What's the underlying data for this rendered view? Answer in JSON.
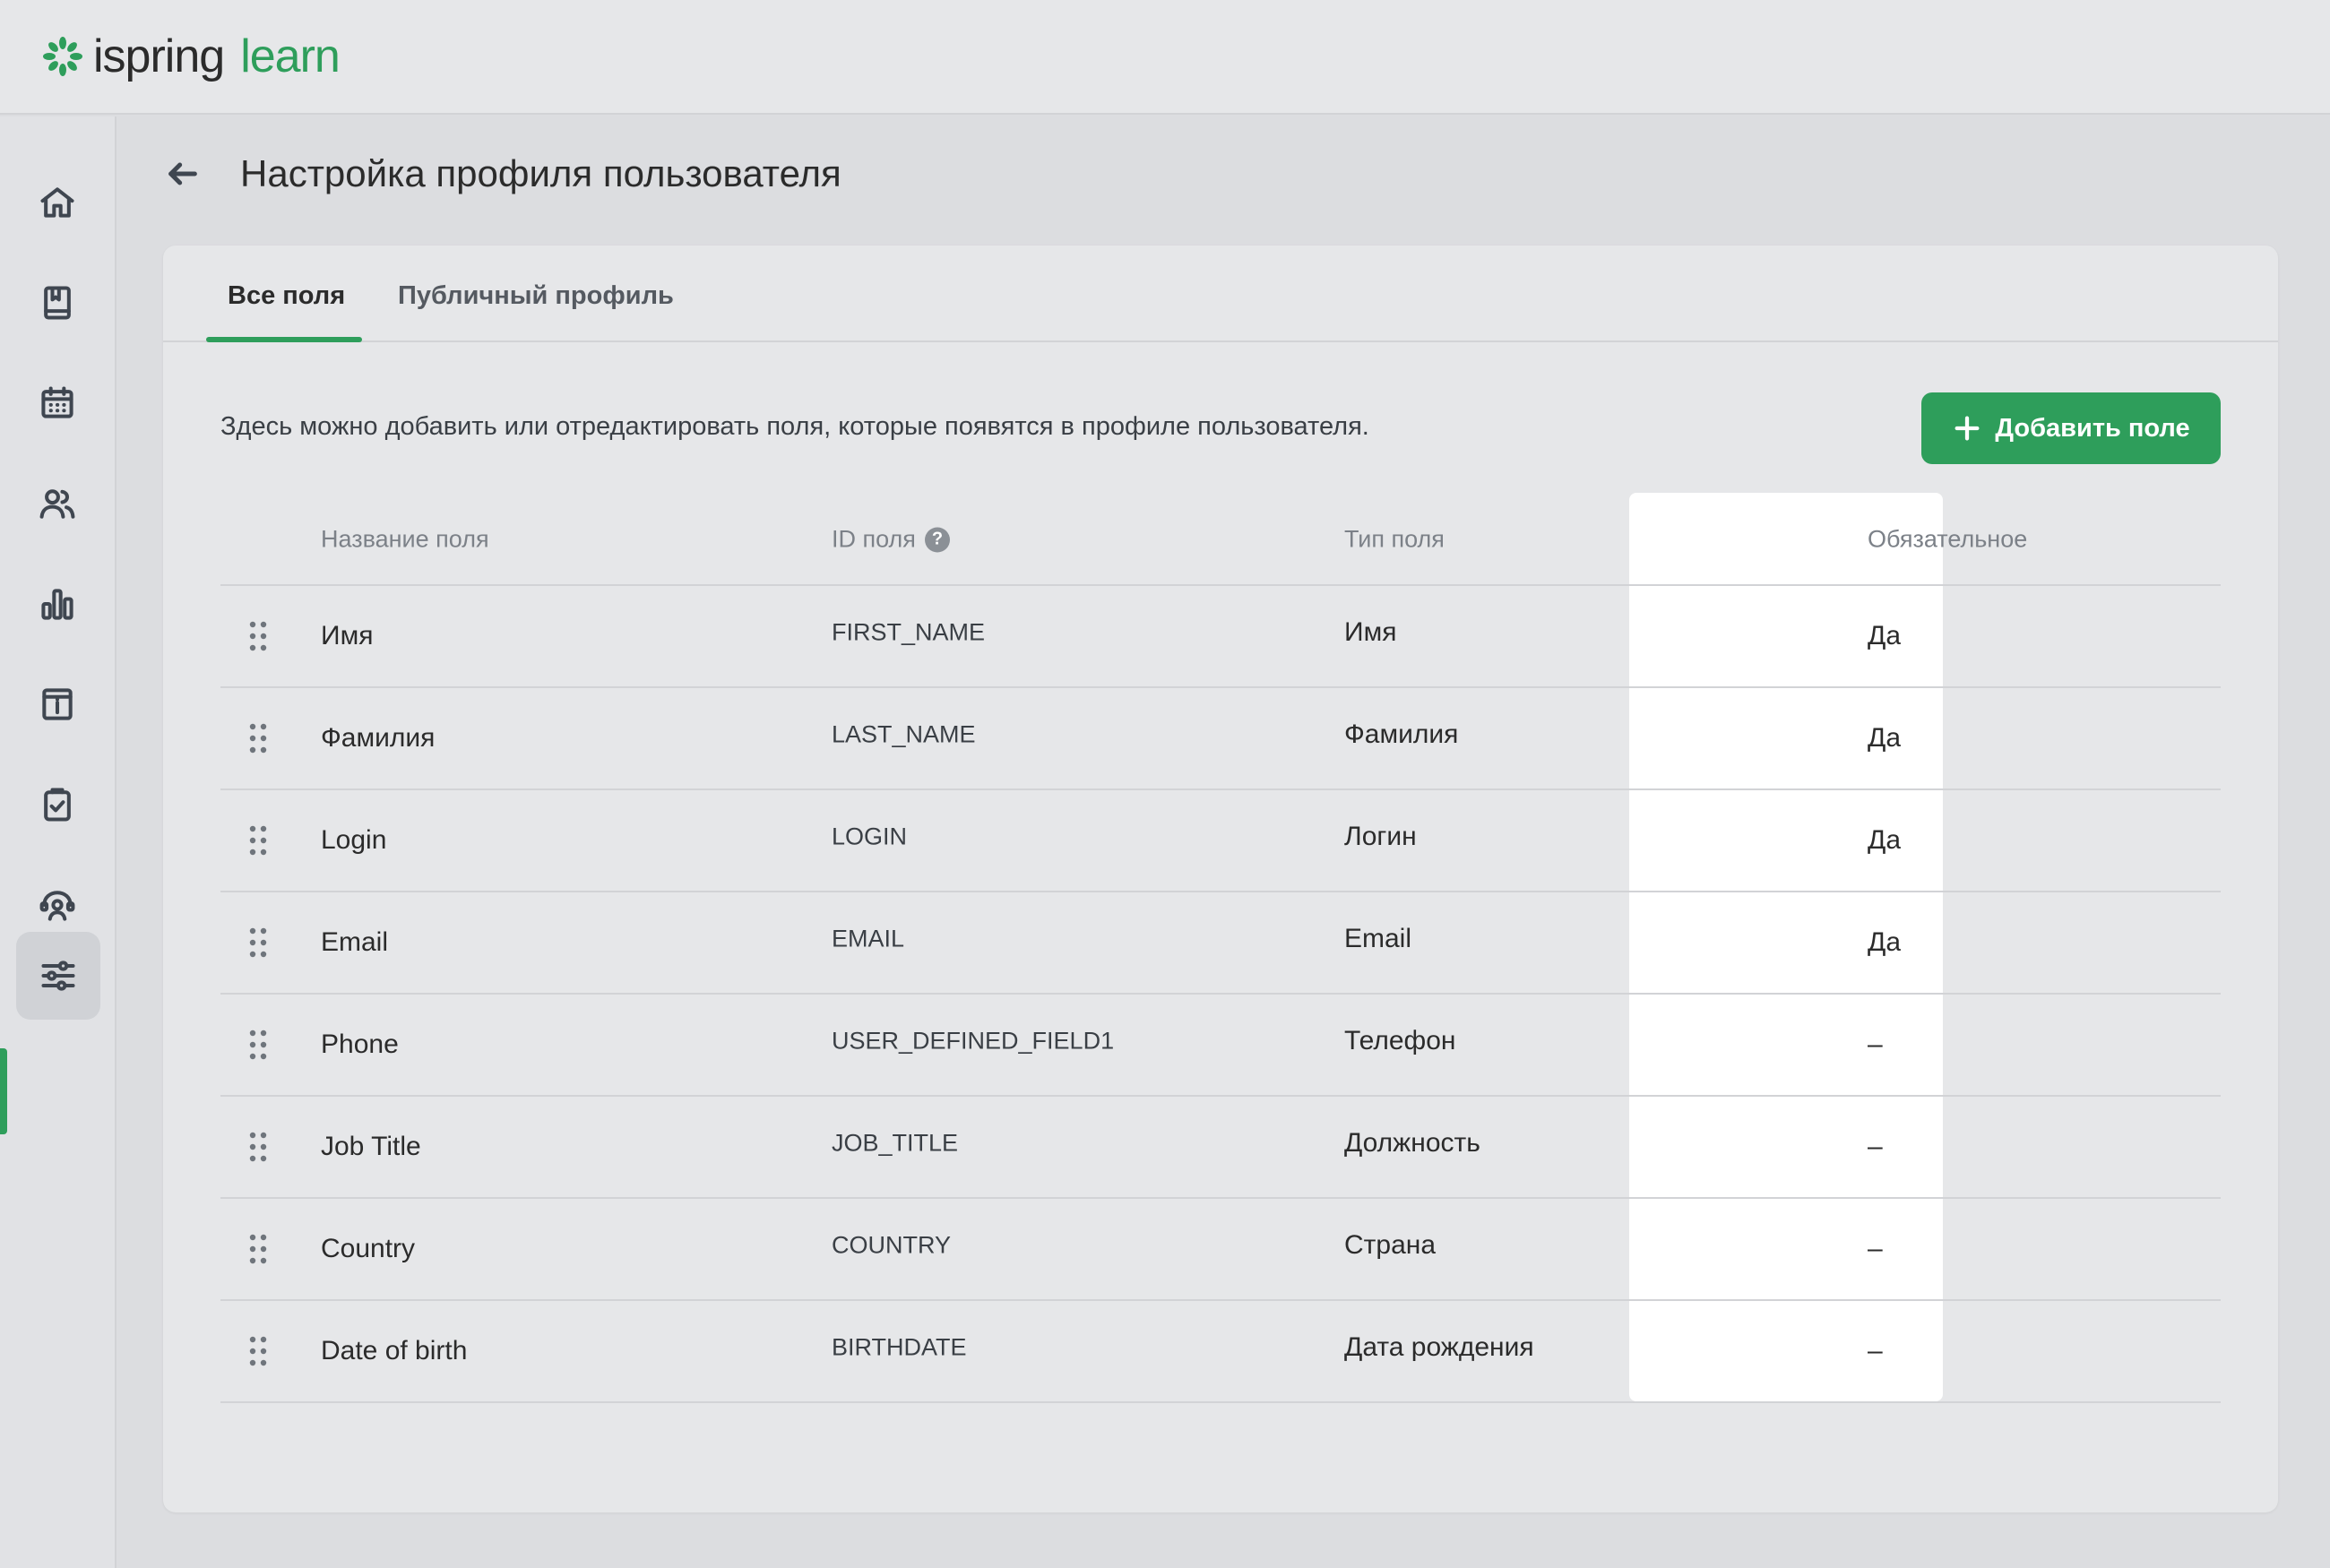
{
  "app": {
    "logo_primary": "ispring",
    "logo_secondary": "learn",
    "brand_color": "#2e9e5b"
  },
  "sidebar": {
    "items": [
      {
        "icon": "home-icon"
      },
      {
        "icon": "book-icon"
      },
      {
        "icon": "calendar-icon"
      },
      {
        "icon": "users-icon"
      },
      {
        "icon": "chart-icon"
      },
      {
        "icon": "info-icon"
      },
      {
        "icon": "clipboard-check-icon"
      },
      {
        "icon": "support-person-icon"
      },
      {
        "icon": "sliders-icon",
        "active": true
      }
    ]
  },
  "header": {
    "title": "Настройка профиля пользователя"
  },
  "tabs": [
    {
      "label": "Все поля",
      "active": true
    },
    {
      "label": "Публичный профиль",
      "active": false
    }
  ],
  "main": {
    "description": "Здесь можно добавить или отредактировать поля, которые появятся в профиле пользователя.",
    "add_button_label": "Добавить поле"
  },
  "table": {
    "columns": {
      "name": "Название поля",
      "id": "ID поля",
      "type": "Тип поля",
      "required": "Обязательное"
    },
    "rows": [
      {
        "name": "Имя",
        "id": "FIRST_NAME",
        "type": "Имя",
        "required": "Да"
      },
      {
        "name": "Фамилия",
        "id": "LAST_NAME",
        "type": "Фамилия",
        "required": "Да"
      },
      {
        "name": "Login",
        "id": "LOGIN",
        "type": "Логин",
        "required": "Да"
      },
      {
        "name": "Email",
        "id": "EMAIL",
        "type": "Email",
        "required": "Да"
      },
      {
        "name": "Phone",
        "id": "USER_DEFINED_FIELD1",
        "type": "Телефон",
        "required": "–"
      },
      {
        "name": "Job Title",
        "id": "JOB_TITLE",
        "type": "Должность",
        "required": "–"
      },
      {
        "name": "Country",
        "id": "COUNTRY",
        "type": "Страна",
        "required": "–"
      },
      {
        "name": "Date of birth",
        "id": "BIRTHDATE",
        "type": "Дата рождения",
        "required": "–"
      }
    ]
  }
}
